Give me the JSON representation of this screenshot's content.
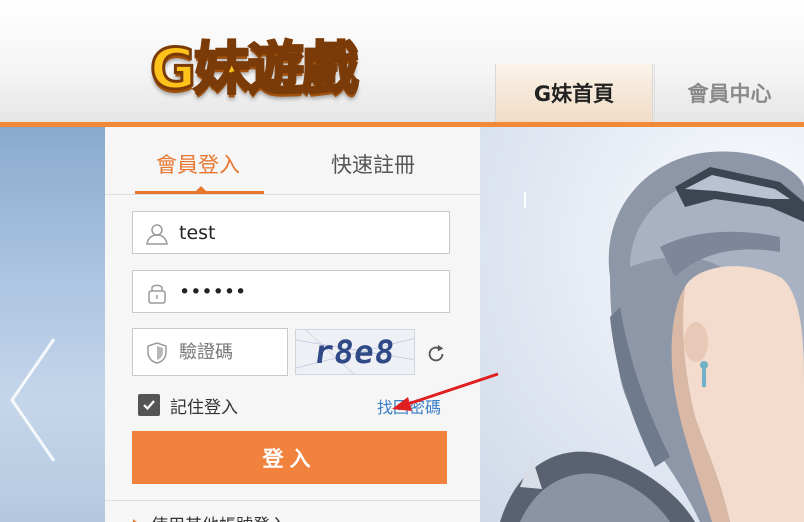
{
  "header": {
    "logo_text": "G妹遊戲",
    "nav": [
      {
        "label": "G妹首頁"
      },
      {
        "label": "會員中心"
      }
    ]
  },
  "login": {
    "tabs": [
      {
        "label": "會員登入",
        "active": true
      },
      {
        "label": "快速註冊",
        "active": false
      }
    ],
    "username_value": "test",
    "password_value": "••••••",
    "captcha_placeholder": "驗證碼",
    "captcha_image_text": "r8e8",
    "remember_label": "記住登入",
    "remember_checked": true,
    "forgot_link": "找回密碼",
    "submit_label": "登入",
    "other_login_label": "使用其他帳號登入"
  },
  "colors": {
    "accent": "#f0823d",
    "link": "#3a7fc8",
    "annotation": "#e02020"
  }
}
